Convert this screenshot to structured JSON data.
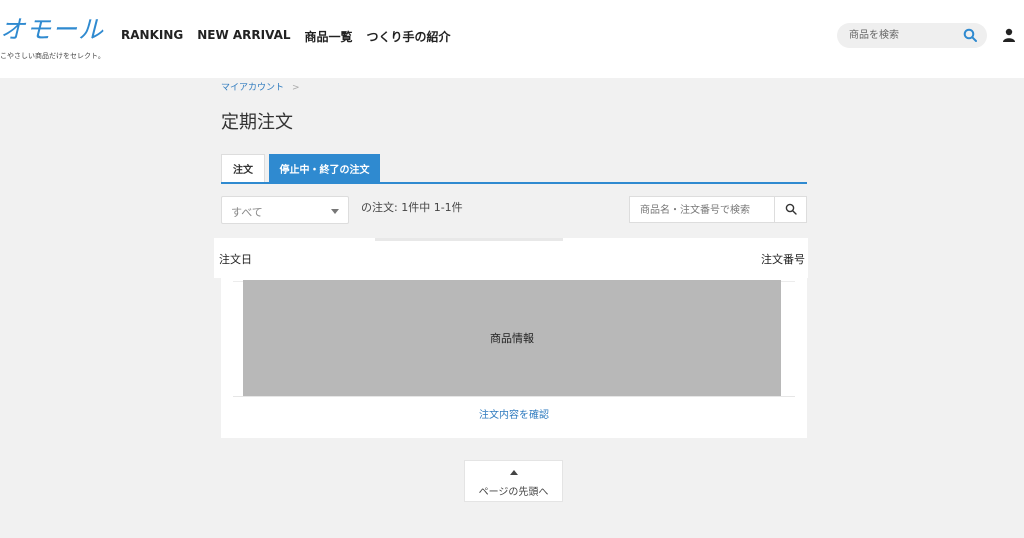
{
  "header": {
    "logo_text": "オモール",
    "logo_tagline": "こやさしい商品だけをセレクト。",
    "nav": [
      "RANKING",
      "NEW ARRIVAL",
      "商品一覧",
      "つくり手の紹介"
    ],
    "search_placeholder": "商品を検索",
    "accent_color": "#2f8ad0"
  },
  "breadcrumb": {
    "item": "マイアカウント",
    "separator": ">"
  },
  "page_title": "定期注文",
  "tabs": [
    {
      "label": "注文",
      "active": false
    },
    {
      "label": "停止中・終了の注文",
      "active": true
    }
  ],
  "filter": {
    "selected": "すべて",
    "count_text": "の注文: 1件中 1-1件"
  },
  "order_search": {
    "placeholder": "商品名・注文番号で検索"
  },
  "table": {
    "col_date": "注文日",
    "col_number": "注文番号"
  },
  "order": {
    "product_info": "商品情報",
    "detail_link": "注文内容を確認"
  },
  "to_top_label": "ページの先頭へ"
}
